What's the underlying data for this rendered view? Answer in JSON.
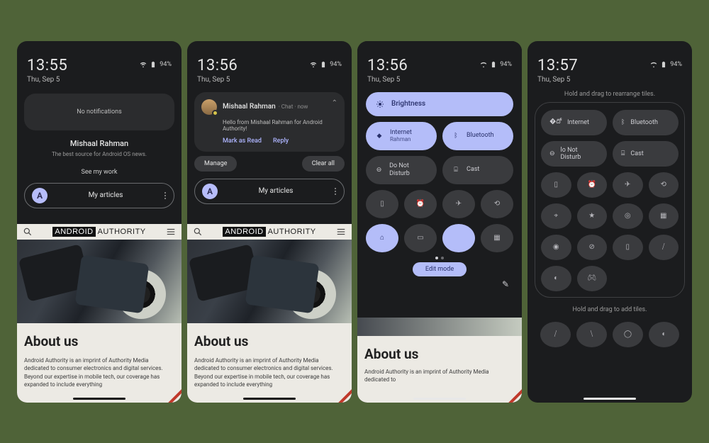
{
  "status": {
    "battery": "94%"
  },
  "p1": {
    "time": "13:55",
    "date": "Thu, Sep 5",
    "no_notif": "No notifications",
    "name": "Mishaal Rahman",
    "tagline": "The best source for Android OS news.",
    "see_work": "See my work",
    "articles": "My articles"
  },
  "p2": {
    "time": "13:56",
    "date": "Thu, Sep 5",
    "sender": "Mishaal Rahman",
    "meta": "· Chat · now ",
    "body": "Hello from Mishaal Rahman for Android Authority!",
    "mark": "Mark as Read",
    "reply": "Reply",
    "manage": "Manage",
    "clear": "Clear all",
    "articles": "My articles"
  },
  "p3": {
    "time": "13:56",
    "date": "Thu, Sep 5",
    "brightness": "Brightness",
    "internet": "Internet",
    "internet_sub": "Rahman",
    "bluetooth": "Bluetooth",
    "dnd": "Do Not Disturb",
    "cast": "Cast",
    "edit": "Edit mode"
  },
  "p4": {
    "time": "13:57",
    "date": "Thu, Sep 5",
    "hint_top": "Hold and drag to rearrange tiles.",
    "hint_bottom": "Hold and drag to add tiles.",
    "internet": "Internet",
    "bluetooth": "Bluetooth",
    "dnd": "lo Not Disturb",
    "cast": "Cast"
  },
  "web": {
    "brand1": "ANDROID",
    "brand2": "AUTHORITY",
    "heading": "About us",
    "para": "Android Authority is an imprint of Authority Media dedicated to consumer electronics and digital services. Beyond our expertise in mobile tech, our coverage has expanded to include everything",
    "para_short": "Android Authority is an imprint of Authority Media dedicated to"
  }
}
